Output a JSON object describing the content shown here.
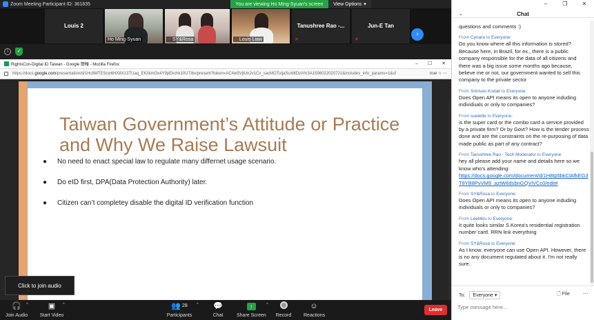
{
  "window": {
    "title": "Zoom Meeting Participant ID: 361835"
  },
  "banner": {
    "viewing_text": "You are viewing Ho Ming-Syuan's screen",
    "view_options": "View Options"
  },
  "gallery": {
    "tiles": [
      {
        "name": "Louis 2"
      },
      {
        "name": "Ho Ming-Syuan"
      },
      {
        "name": "SY&Rosa"
      },
      {
        "name": "Louis Liaw"
      },
      {
        "name": "Tanushree Rao -..."
      },
      {
        "name": "Jun-E Tan"
      }
    ]
  },
  "browser": {
    "title": "RightsCon-Digital ID Taiwan - Google 簡報 - Mozilla Firefox",
    "url_prefix": "https://docs.",
    "url_domain": "google.com",
    "url_rest": "/presentation/d/1Hc8MTEScw6HX8X13TUaq_EK/ikmOx4Y9pEkchk10UTIbv/present?token=AC4w5VjtUn2v1Cx_sacMOTuljaSc/d6DzA%3A1596022020721&includes_info_params=1&sf",
    "url_right": "true ☆ ⋯"
  },
  "slide": {
    "title_line1": "Taiwan Government’s Attitude or Practice",
    "title_line2": "and Why We Raise Lawsuit",
    "bullets": [
      "No need to enact special law to regulate many differnet usage scenario.",
      "Do eID first, DPA(Data Protection Authority) later.",
      "Citizen can’t completey disable the digital ID verification function"
    ],
    "bullet_glyph": "●"
  },
  "tooltip": {
    "text": "Click to join audio"
  },
  "toolbar": {
    "join_audio": "Join Audio",
    "start_video": "Start Video",
    "participants": "Participants",
    "participants_count": "28",
    "chat": "Chat",
    "share_screen": "Share Screen",
    "record": "Record",
    "reactions": "Reactions",
    "leave": "Leave"
  },
  "chat": {
    "title": "Chat",
    "first_text": "questions and comments :)",
    "messages": [
      {
        "from": "Cynara",
        "to": "Everyone",
        "text": "Do you know where all this information is stored? Because here, in Brazil, for ex., there is a public company responsible for the data of all citizens and there was a big issue some months ago because, believe me or not, our government wanted to sell this company to the private sector"
      },
      {
        "from": "Srinivas Kodali",
        "to": "Everyone",
        "text": "Does Open API means its open to anyone induding individuals or only to companies?"
      },
      {
        "from": "suelette",
        "to": "Everyone",
        "text": "is the super card or the combo card a service provided by a private firm? Or by Govt? How is the tender process done and are the constraints on the re-purposing of data made public as part of any contract?"
      },
      {
        "from": "Tanushree Rao - Tech Moderator",
        "to": "Everyone",
        "text": "hey all please add your name and details here so we know who's attending:",
        "link": "https://docs.google.com/document/d/1H8tp5bkClAfkEG3T8YB8PvVM9_aztW6dsbnGQViVCc0/edit#"
      },
      {
        "from": "SY&Rosa",
        "to": "Everyone",
        "text": "Does Open API means its open to anyone induding individuals or only to companies?"
      },
      {
        "from": "LeeMiru",
        "to": "Everyone",
        "text": "It quite looks similar S.Korea's residential registration number card. RRN link everything"
      },
      {
        "from": "SY&Rosa",
        "to": "Everyone",
        "text": "As I know, everyone can use Open API. However, there is no any document regulated about it. I'm not really sure."
      }
    ],
    "from_prefix": "From",
    "to_word": "to",
    "to_label": "To:",
    "to_value": "Everyone",
    "file_label": "File",
    "input_placeholder": "Type message here..."
  },
  "colors": {
    "zoom_blue": "#2d8cff",
    "share_green": "#25a244",
    "leave_red": "#e02f2f",
    "slide_title": "#a97a51"
  }
}
